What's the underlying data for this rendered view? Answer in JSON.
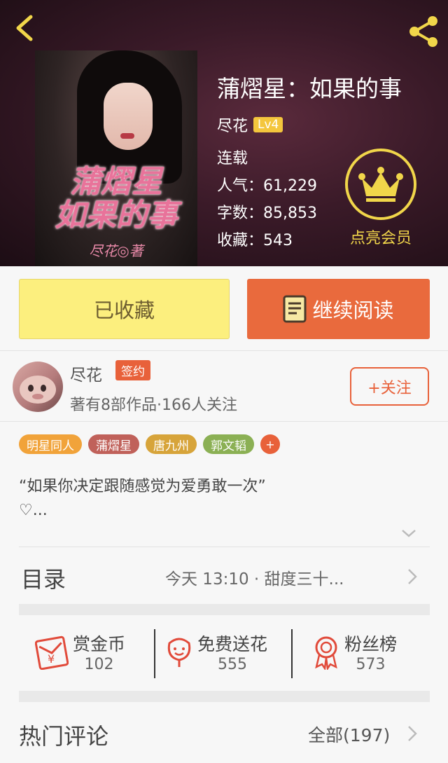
{
  "book": {
    "title": "蒲熠星：如果的事",
    "cover_title_line1": "蒲熠星",
    "cover_title_line2": "如果的事",
    "cover_author": "尽花◎著",
    "author": "尽花",
    "level": "Lv4",
    "status": "连载",
    "popularity": "人气：61,229",
    "word_count": "字数：85,853",
    "favorites": "收藏：543"
  },
  "vip": {
    "label": "点亮会员"
  },
  "actions": {
    "collected_label": "已收藏",
    "read_label": "继续阅读"
  },
  "author_card": {
    "name": "尽花",
    "badge": "签约",
    "stats": "著有8部作品·166人关注",
    "follow_label": "+关注"
  },
  "tags": [
    {
      "label": "明星同人",
      "color": "#f1a33a"
    },
    {
      "label": "蒲熠星",
      "color": "#c0615a"
    },
    {
      "label": "唐九州",
      "color": "#d7a43a"
    },
    {
      "label": "郭文韬",
      "color": "#8bb054"
    }
  ],
  "tag_more": "+",
  "intro": {
    "line1": "“如果你决定跟随感觉为爱勇敢一次”",
    "line2": "♡..."
  },
  "toc": {
    "label": "目录",
    "latest": "今天 13:10 · 甜度三十..."
  },
  "stats": {
    "reward": {
      "label": "赏金币",
      "value": "102"
    },
    "flowers": {
      "label": "免费送花",
      "value": "555"
    },
    "fans": {
      "label": "粉丝榜",
      "value": "573"
    }
  },
  "comments": {
    "label": "热门评论",
    "all_label": "全部(197)"
  },
  "colors": {
    "accent": "#e8613a",
    "gold": "#f1d64a",
    "collected_bg": "#fcef7e"
  },
  "icons": [
    "back-icon",
    "share-icon",
    "crown-icon",
    "book-icon",
    "chevron-down-icon",
    "chevron-right-icon",
    "red-envelope-icon",
    "flower-icon",
    "medal-icon"
  ]
}
